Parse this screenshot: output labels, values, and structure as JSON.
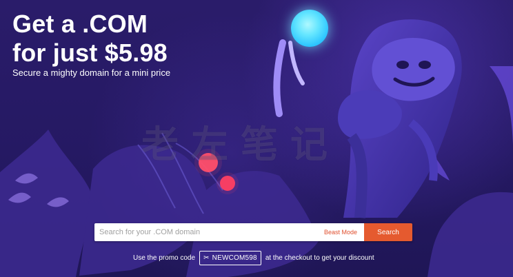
{
  "hero": {
    "headline_line1": "Get a .COM",
    "headline_line2": "for just $5.98",
    "subheadline": "Secure a mighty domain for a mini price"
  },
  "search": {
    "placeholder": "Search for your .COM domain",
    "value": "",
    "beast_mode_label": "Beast Mode",
    "button_label": "Search"
  },
  "promo": {
    "prefix": "Use the promo code",
    "code": "NEWCOM598",
    "suffix": "at the checkout to get your discount"
  },
  "watermark": {
    "text": "老左笔记"
  },
  "colors": {
    "background": "#2b1d6b",
    "search_button": "#e55a2f",
    "beast_mode": "#e04f2e",
    "moon": "#65e6ff"
  }
}
